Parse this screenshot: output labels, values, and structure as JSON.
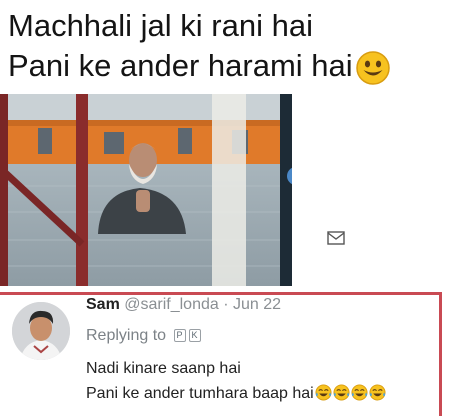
{
  "caption": {
    "line1": "Machhali jal ki rani hai",
    "line2": "Pani ke ander harami hai"
  },
  "icons": {
    "caption_emoji": "smiley-face-emoji-icon",
    "mail": "envelope-icon",
    "laugh": "tears-of-joy-emoji-icon"
  },
  "tweet": {
    "name": "Sam",
    "handle": "@sarif_londa",
    "separator": "·",
    "date": "Jun 22",
    "replying_label": "Replying to",
    "reply_badges": [
      "P",
      "K"
    ],
    "lines": [
      "Nadi kinare saanp hai",
      "Pani ke ander tumhara baap hai"
    ]
  },
  "colors": {
    "frame_red": "#c94a53",
    "text_gray": "#8a8f93"
  }
}
